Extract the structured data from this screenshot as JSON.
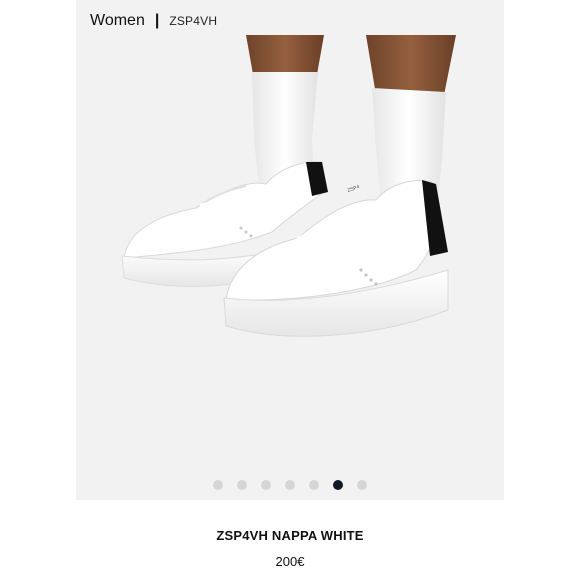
{
  "breadcrumb": {
    "category": "Women",
    "separator": "|",
    "model": "ZSP4VH"
  },
  "gallery": {
    "image_count": 7,
    "active_index": 5
  },
  "product": {
    "name": "ZSP4VH NAPPA WHITE",
    "price": "200€"
  },
  "colors": {
    "background": "#f2f2f2",
    "dot_inactive": "#d6d6d6",
    "dot_active": "#111827",
    "skin": "#8b5a3c",
    "sneaker": "#ffffff",
    "heel_tab": "#111111"
  },
  "icons": {
    "product_image": "sneakers-photo"
  }
}
